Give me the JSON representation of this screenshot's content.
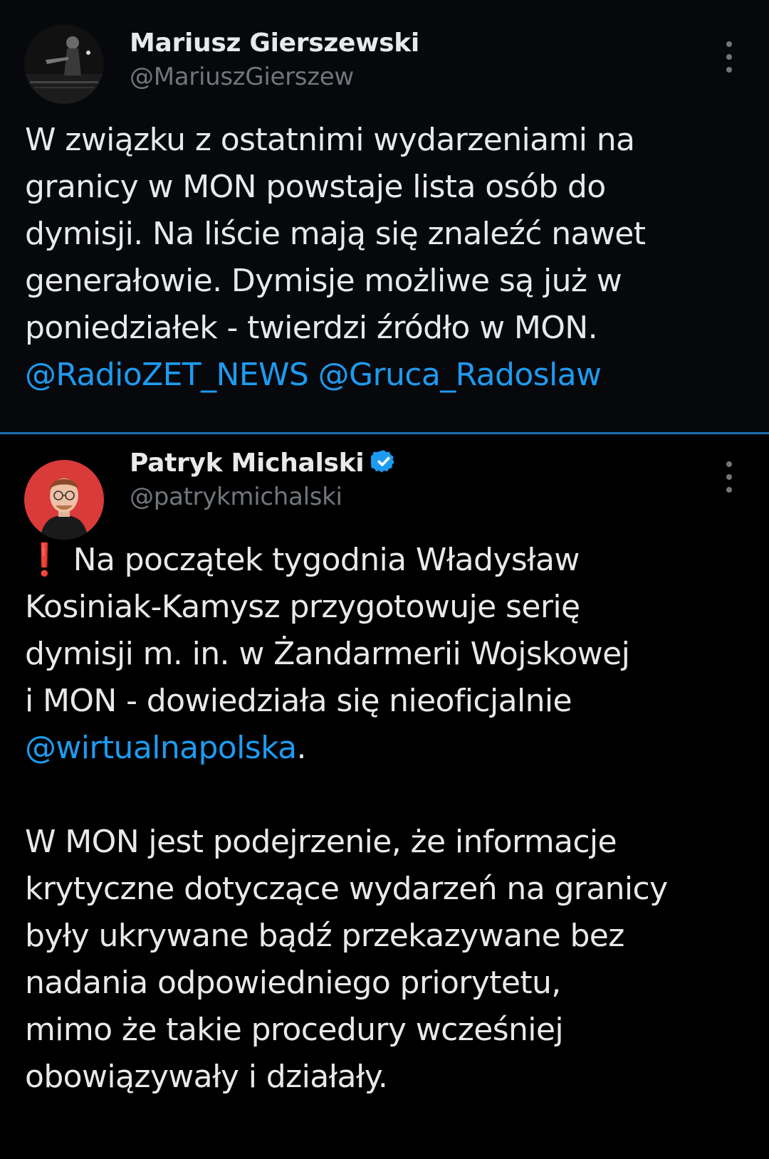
{
  "tweets": [
    {
      "author_name": "Mariusz Gierszewski",
      "author_handle": "@MariuszGierszew",
      "verified": false,
      "body_lines": [
        "W związku z ostatnimi wydarzeniami na",
        "granicy w MON powstaje lista osób do",
        "dymisji. Na liście mają się znaleźć nawet",
        "generałowie. Dymisje możliwe są już w",
        "poniedziałek - twierdzi źródło w MON."
      ],
      "mentions": [
        "@RadioZET_NEWS",
        "@Gruca_Radoslaw"
      ]
    },
    {
      "author_name": "Patryk Michalski",
      "author_handle": "@patrykmichalski",
      "verified": true,
      "exclamation_emoji": "❗",
      "body_lines": [
        "Na początek tygodnia Władysław",
        "Kosiniak-Kamysz przygotowuje serię",
        "dymisji m. in. w Żandarmerii Wojskowej",
        "i MON - dowiedziała się nieoficjalnie"
      ],
      "mention": "@wirtualnapolska",
      "mention_suffix": ".",
      "paragraph2_lines": [
        "W MON jest podejrzenie, że informacje",
        "krytyczne dotyczące wydarzeń na granicy",
        "były ukrywane bądź przekazywane bez",
        "nadania odpowiedniego priorytetu,",
        "mimo że takie procedury wcześniej",
        "obowiązywały i działały."
      ]
    }
  ],
  "colors": {
    "background": "#000000",
    "text": "#e7e9ea",
    "secondary": "#71767b",
    "link": "#1d9bf0",
    "divider": "#1f6fae",
    "verified": "#1d9bf0"
  }
}
